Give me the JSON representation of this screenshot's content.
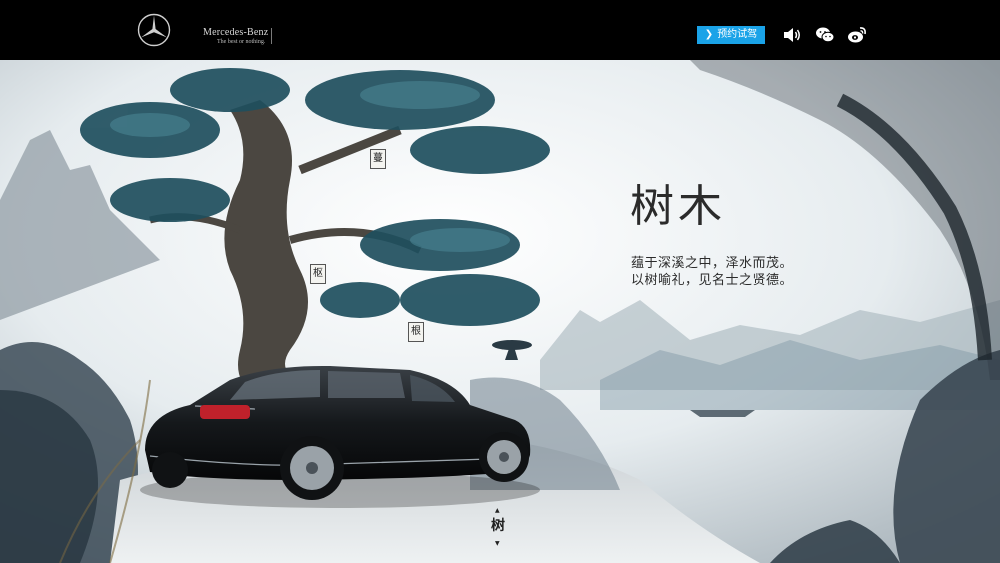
{
  "header": {
    "brand_name": "Mercedes-Benz",
    "brand_slogan": "The best or nothing.",
    "cta_label": "预约试驾",
    "cta_color": "#1aa3e8",
    "icons": [
      "mercedes-star-icon",
      "speaker-icon",
      "wechat-icon",
      "weibo-icon"
    ]
  },
  "scene": {
    "hotspots": [
      "蔓",
      "枢",
      "根"
    ],
    "title": "树木",
    "verse": [
      "蕴于深溪之中，泽水而茂。",
      "以树喻礼，见名士之贤德。"
    ]
  },
  "nav": {
    "current": "树",
    "up_arrow": "▲",
    "down_arrow": "▼"
  }
}
